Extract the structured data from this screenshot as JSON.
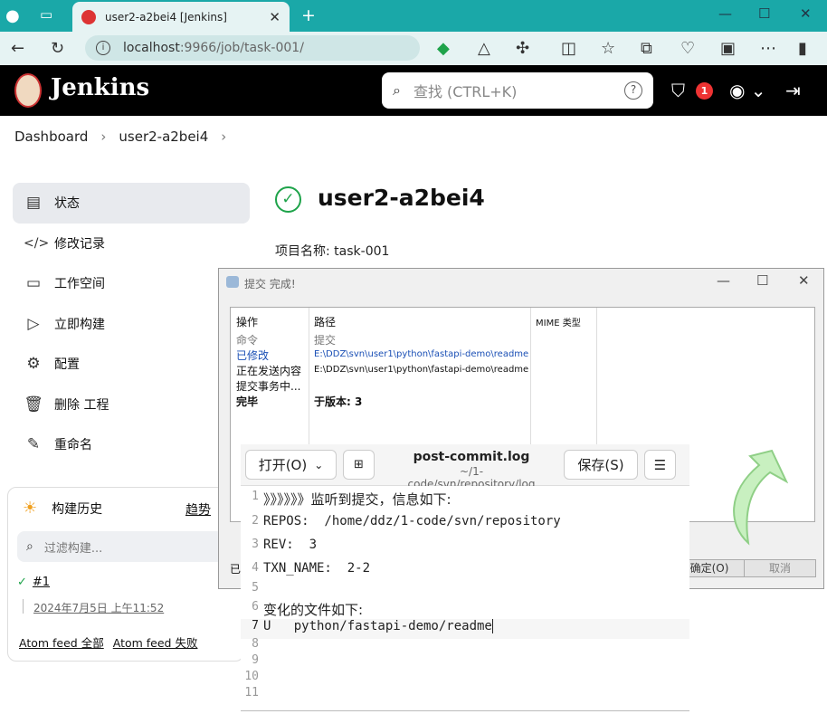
{
  "browser": {
    "tab_title": "user2-a2bei4 [Jenkins]",
    "url_host": "localhost",
    "url_rest": ":9966/job/task-001/"
  },
  "header": {
    "title": "Jenkins",
    "search_placeholder": "查找 (CTRL+K)",
    "notification_count": "1"
  },
  "breadcrumb": {
    "items": [
      "Dashboard",
      "user2-a2bei4"
    ]
  },
  "sidebar": {
    "items": [
      {
        "label": "状态",
        "icon": "status-icon"
      },
      {
        "label": "修改记录",
        "icon": "code-icon"
      },
      {
        "label": "工作空间",
        "icon": "folder-icon"
      },
      {
        "label": "立即构建",
        "icon": "play-icon"
      },
      {
        "label": "配置",
        "icon": "gear-icon"
      },
      {
        "label": "删除 工程",
        "icon": "trash-icon"
      },
      {
        "label": "重命名",
        "icon": "pencil-icon"
      }
    ]
  },
  "main": {
    "title": "user2-a2bei4",
    "project_name": "项目名称: task-001"
  },
  "build_history": {
    "title": "构建历史",
    "trend": "趋势",
    "filter_placeholder": "过滤构建...",
    "build_number": "#1",
    "build_date": "2024年7月5日 上午11:52",
    "feed_all": "Atom feed 全部",
    "feed_failed": "Atom feed 失败"
  },
  "commit_dialog": {
    "title": "提交 完成!",
    "columns": [
      "操作",
      "路径",
      "MIME 类型"
    ],
    "rows": [
      {
        "action": "命令",
        "path": "提交"
      },
      {
        "action": "已修改",
        "path": "E:\\DDZ\\svn\\user1\\python\\fastapi-demo\\readme"
      },
      {
        "action": "正在发送内容",
        "path": "E:\\DDZ\\svn\\user1\\python\\fastapi-demo\\readme"
      },
      {
        "action": "提交事务中...",
        "path": ""
      },
      {
        "action": "完毕",
        "path": "于版本: 3"
      }
    ],
    "bottom_left": "已",
    "ok_button": "确定(O)",
    "cancel_button": "取消"
  },
  "editor": {
    "open_button": "打开(O)",
    "file_name": "post-commit.log",
    "file_path": "~/1-code/svn/repository/log",
    "save_button": "保存(S)",
    "lines": [
      "》》》》》》监听到提交，信息如下:",
      "REPOS:  /home/ddz/1-code/svn/repository",
      "REV:  3",
      "TXN_NAME:  2-2",
      "",
      "变化的文件如下:",
      "U   python/fastapi-demo/readme",
      "",
      "",
      "",
      ""
    ],
    "line_numbers": [
      "1",
      "2",
      "3",
      "4",
      "5",
      "6",
      "7",
      "8",
      "9",
      "10",
      "11"
    ]
  },
  "colors": {
    "browser_accent": "#1aa8a8",
    "jenkins_header": "#000000",
    "success": "#1ea34a",
    "link_blue": "#1a4fb5"
  }
}
